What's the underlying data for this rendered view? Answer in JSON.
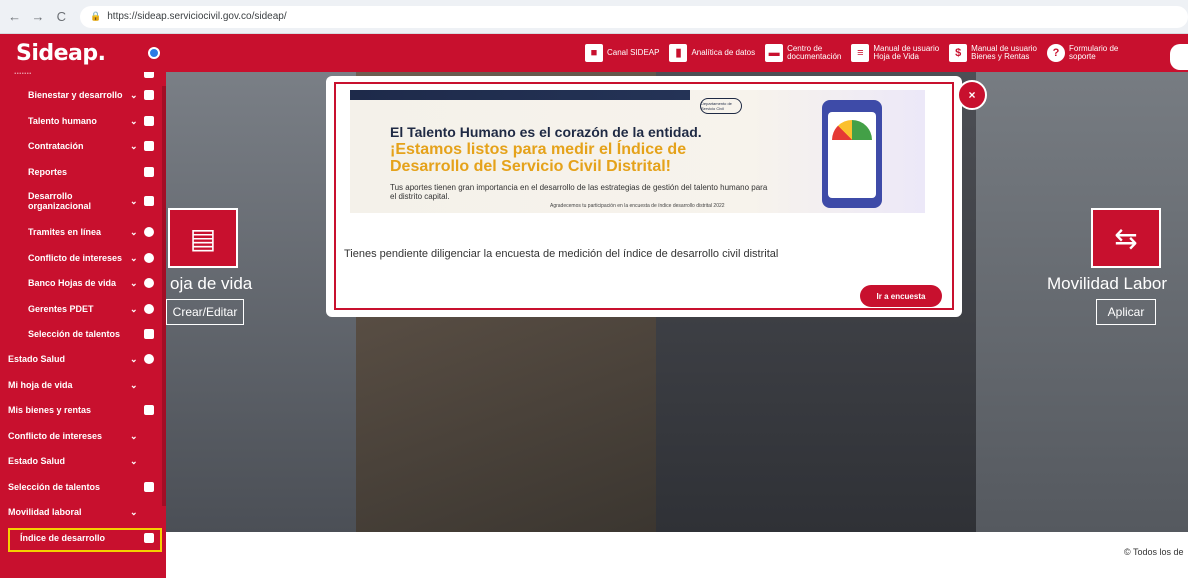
{
  "browser": {
    "url": "https://sideap.serviciocivil.gov.co/sideap/",
    "back_icon": "back-arrow-icon",
    "forward_icon": "forward-arrow-icon",
    "reload_icon": "reload-icon"
  },
  "header": {
    "logo": "Sideap.",
    "links": [
      {
        "label": "Canal SIDEAP",
        "icon": "video-camera-icon"
      },
      {
        "label": "Analítica de datos",
        "icon": "bar-chart-icon"
      },
      {
        "label_line1": "Centro de",
        "label_line2": "documentación",
        "icon": "document-center-icon"
      },
      {
        "label_line1": "Manual de usuario",
        "label_line2": "Hoja de Vida",
        "icon": "manual-icon"
      },
      {
        "label_line1": "Manual de usuario",
        "label_line2": "Bienes y Rentas",
        "icon": "money-manual-icon"
      },
      {
        "label_line1": "Formulario de",
        "label_line2": "soporte",
        "icon": "help-icon"
      }
    ]
  },
  "sidebar": {
    "items": [
      {
        "label": "Bienestar y desarrollo"
      },
      {
        "label": "Talento humano"
      },
      {
        "label": "Contratación"
      },
      {
        "label": "Reportes"
      },
      {
        "label_line1": "Desarrollo",
        "label_line2": "organizacional"
      },
      {
        "label": "Tramites en línea"
      },
      {
        "label": "Conflicto de intereses"
      },
      {
        "label": "Banco Hojas de vida"
      },
      {
        "label": "Gerentes PDET"
      },
      {
        "label": "Selección de talentos"
      },
      {
        "label": "Estado Salud"
      },
      {
        "label": "Mi hoja de vida"
      },
      {
        "label": "Mis bienes y rentas"
      },
      {
        "label": "Conflicto de intereses"
      },
      {
        "label": "Estado Salud"
      },
      {
        "label": "Selección de talentos"
      },
      {
        "label": "Movilidad laboral"
      },
      {
        "label": "Índice de desarrollo"
      }
    ]
  },
  "cards": {
    "hoja_title": "oja de vida",
    "hoja_button": "Crear/Editar",
    "movilidad_title": "Movilidad Labor",
    "movilidad_button": "Aplicar"
  },
  "modal": {
    "banner": {
      "line1": "El Talento Humano es el corazón de la entidad.",
      "line2": "¡Estamos listos para medir el Índice de",
      "line3": "Desarrollo del Servicio Civil Distrital!",
      "paragraph": "Tus aportes tienen gran importancia en el desarrollo de las estrategias de gestión del talento humano para el distrito capital.",
      "small": "Agradecemos tu participación en la encuesta de índice desarrollo distrital 2022",
      "badge": "Departamento de Servicio Civil"
    },
    "message": "Tienes pendiente diligenciar la encuesta de medición del índice de desarrollo civil distrital",
    "button": "Ir a encuesta",
    "close": "×"
  },
  "footer": {
    "text": "Todos los de",
    "icon": "copyright-icon"
  },
  "colors": {
    "brand": "#c8102e",
    "highlight": "#f5d000",
    "accent_blue": "#2c7be5"
  }
}
